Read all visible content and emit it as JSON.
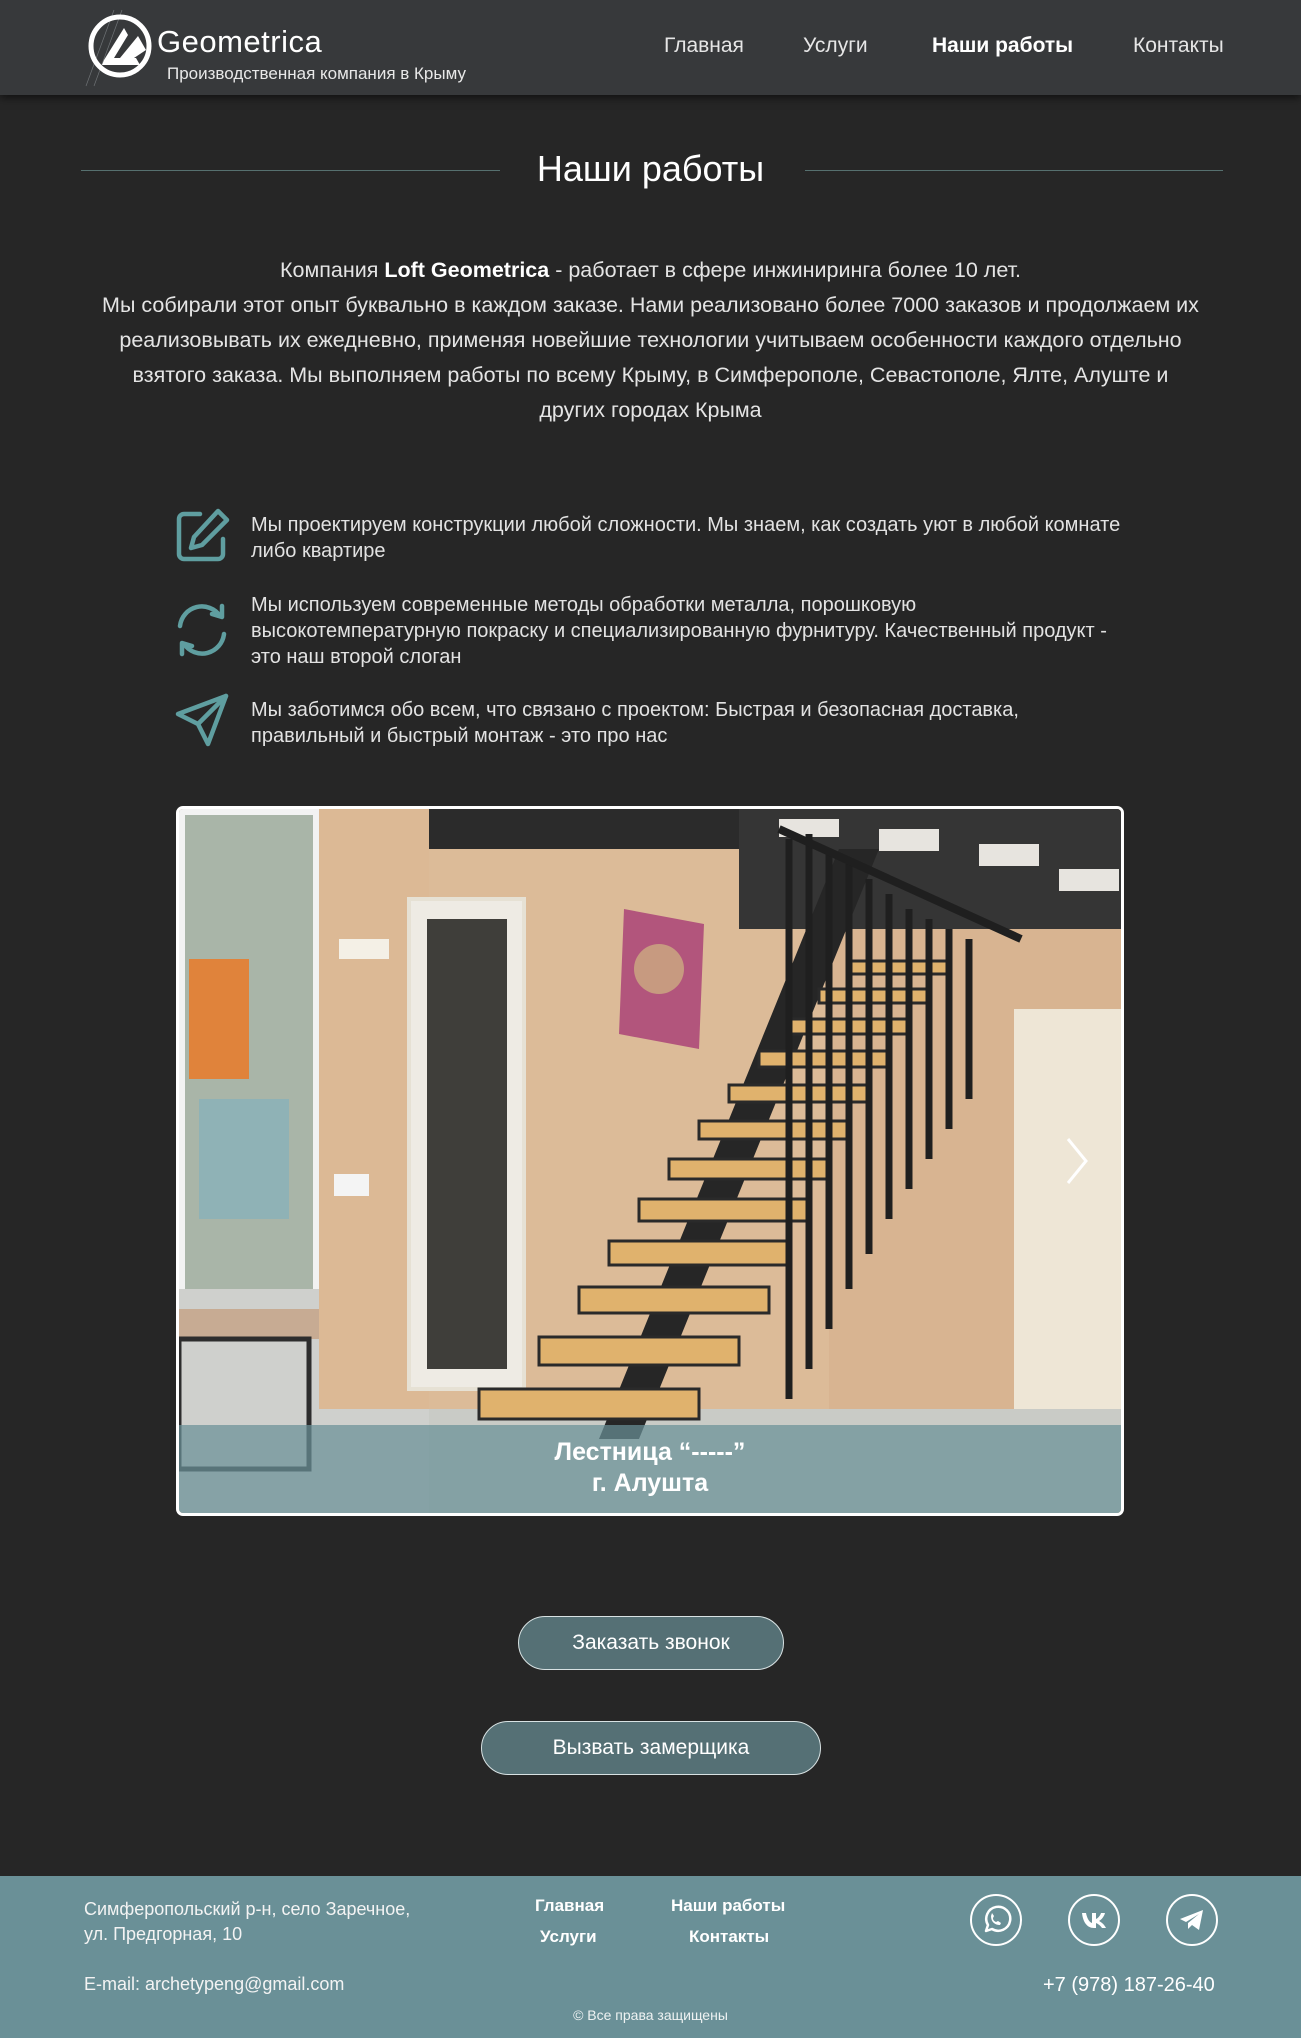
{
  "header": {
    "brand_name": "Geometrica",
    "brand_tagline": "Производственная компания в Крыму",
    "nav": [
      {
        "label": "Главная",
        "active": false
      },
      {
        "label": "Услуги",
        "active": false
      },
      {
        "label": "Наши работы",
        "active": true
      },
      {
        "label": "Контакты",
        "active": false
      }
    ]
  },
  "page_title": "Наши работы",
  "intro": {
    "line1_prefix": "Компания ",
    "line1_bold": "Loft Geometrica",
    "line1_suffix": " - работает в сфере инжиниринга более 10 лет.",
    "rest": "Мы собирали этот опыт буквально в каждом заказе. Нами реализовано более 7000 заказов и продолжаем их реализовывать их ежедневно, применяя новейшие технологии учитываем особенности каждого отдельно взятого заказа. Мы выполняем работы по всему Крыму, в Симферополе, Севастополе, Ялте, Алуште и других городах Крыма"
  },
  "features": [
    {
      "icon": "edit-icon",
      "text": "Мы проектируем конструкции любой сложности. Мы знаем, как создать уют в любой комнате либо квартире"
    },
    {
      "icon": "refresh-icon",
      "text": "Мы используем современные методы обработки металла, порошковую высокотемпературную покраску и специализированную фурнитуру. Качественный продукт - это наш второй слоган"
    },
    {
      "icon": "send-icon",
      "text": "Мы заботимся обо всем, что связано с проектом: Быстрая и безопасная доставка, правильный и быстрый монтаж - это про нас"
    }
  ],
  "slider": {
    "caption_line1": "Лестница “-----”",
    "caption_line2": "г. Алушта"
  },
  "buttons": {
    "call": "Заказать звонок",
    "measure": "Вызвать замерщика"
  },
  "footer": {
    "address_line1": "Симферопольский р-н, село Заречное,",
    "address_line2": "ул. Предгорная, 10",
    "email": "E-mail: archetypeng@gmail.com",
    "links": [
      "Главная",
      "Наши работы",
      "Услуги",
      "Контакты"
    ],
    "copyright": "© Все права защищены",
    "phone": "+7 (978) 187-26-40",
    "social": [
      "whatsapp-icon",
      "vk-icon",
      "telegram-icon"
    ]
  },
  "colors": {
    "background": "#262626",
    "header": "#37393b",
    "accent": "#6a9097",
    "button": "#557075",
    "icon": "#5f9ea0"
  }
}
